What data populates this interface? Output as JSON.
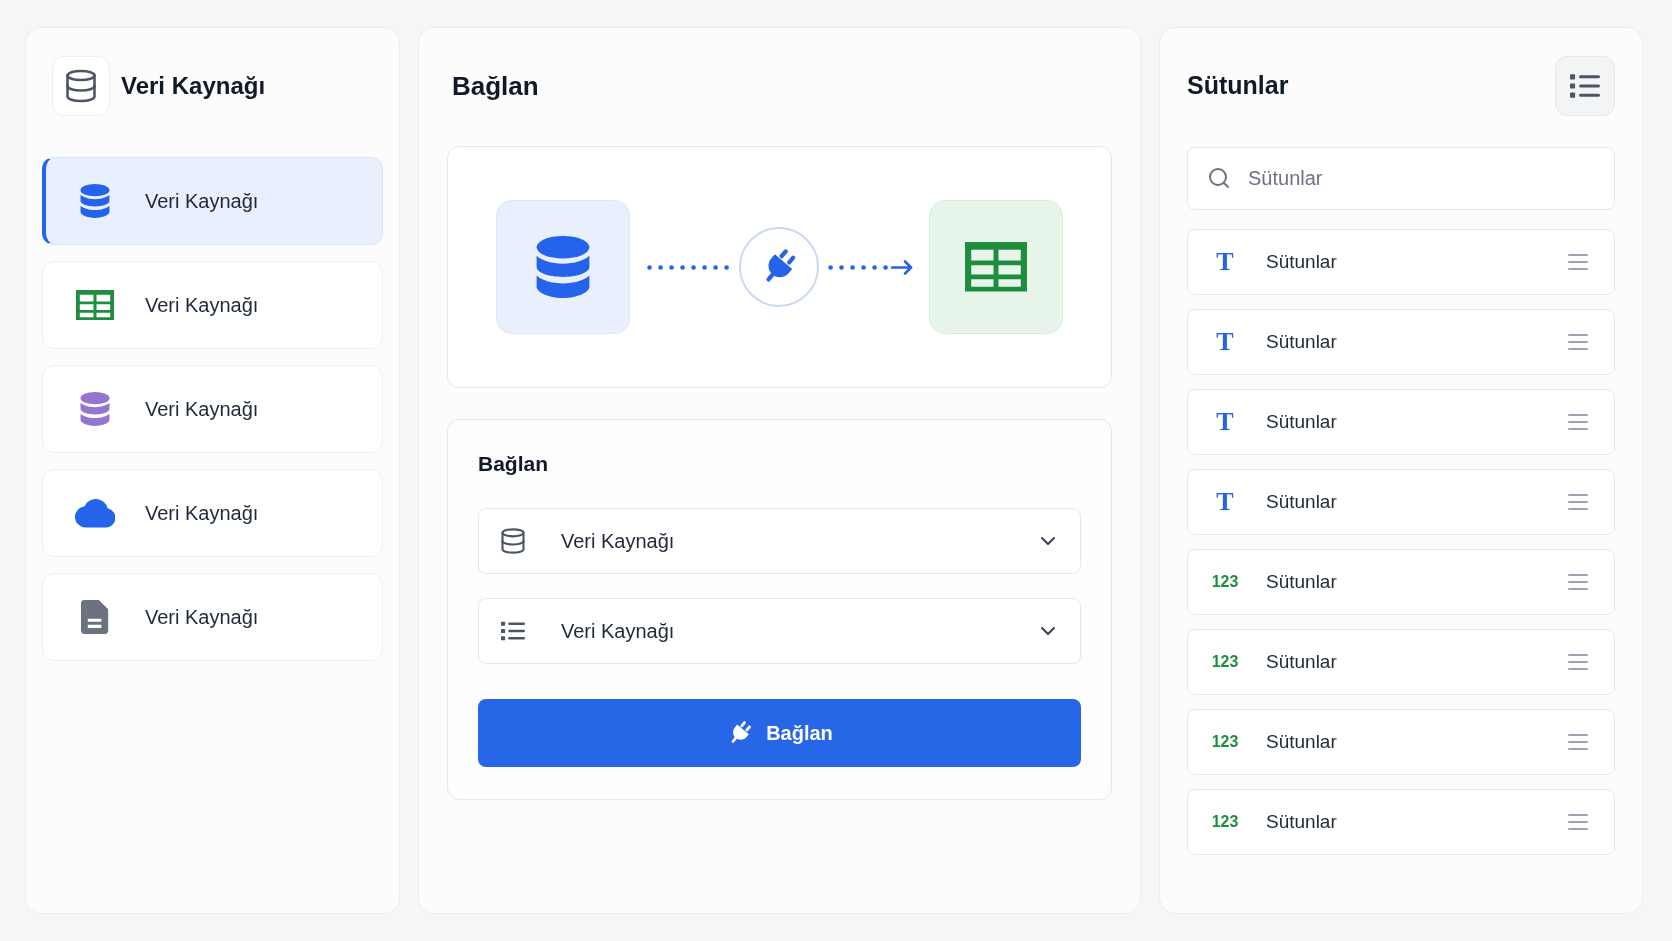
{
  "sidebar": {
    "title": "Veri Kaynağı",
    "items": [
      {
        "label": "Veri Kaynağı",
        "kind": "database",
        "color": "#2563eb",
        "selected": true
      },
      {
        "label": "Veri Kaynağı",
        "kind": "spreadsheet",
        "color": "#1e8e3e",
        "selected": false
      },
      {
        "label": "Veri Kaynağı",
        "kind": "database",
        "color": "#9575cd",
        "selected": false
      },
      {
        "label": "Veri Kaynağı",
        "kind": "cloud",
        "color": "#2563eb",
        "selected": false
      },
      {
        "label": "Veri Kaynağı",
        "kind": "document",
        "color": "#6b7280",
        "selected": false
      }
    ]
  },
  "connect": {
    "title": "Bağlan",
    "form": {
      "title": "Bağlan",
      "selects": [
        {
          "kind": "database",
          "value": "Veri Kaynağı"
        },
        {
          "kind": "list",
          "value": "Veri Kaynağı"
        }
      ],
      "button": "Bağlan"
    }
  },
  "columns": {
    "title": "Sütunlar",
    "search": {
      "placeholder": "Sütunlar"
    },
    "items": [
      {
        "kind": "text",
        "badge": "T",
        "label": "Sütunlar"
      },
      {
        "kind": "text",
        "badge": "T",
        "label": "Sütunlar"
      },
      {
        "kind": "text",
        "badge": "T",
        "label": "Sütunlar"
      },
      {
        "kind": "text",
        "badge": "T",
        "label": "Sütunlar"
      },
      {
        "kind": "number",
        "badge": "123",
        "label": "Sütunlar"
      },
      {
        "kind": "number",
        "badge": "123",
        "label": "Sütunlar"
      },
      {
        "kind": "number",
        "badge": "123",
        "label": "Sütunlar"
      },
      {
        "kind": "number",
        "badge": "123",
        "label": "Sütunlar"
      }
    ]
  }
}
